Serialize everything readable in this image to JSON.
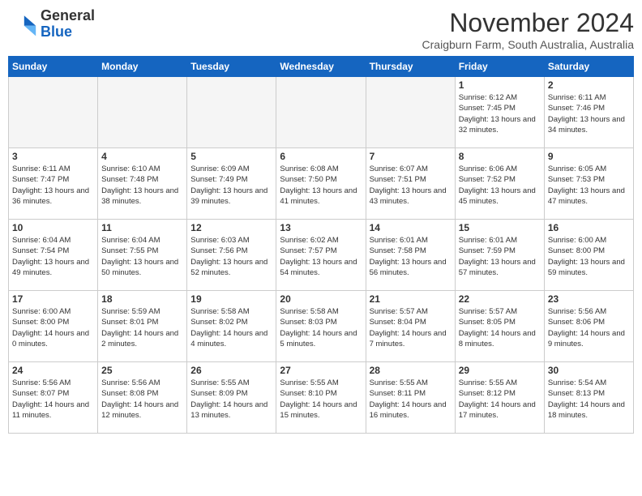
{
  "header": {
    "logo_line1": "General",
    "logo_line2": "Blue",
    "month": "November 2024",
    "location": "Craigburn Farm, South Australia, Australia"
  },
  "days_of_week": [
    "Sunday",
    "Monday",
    "Tuesday",
    "Wednesday",
    "Thursday",
    "Friday",
    "Saturday"
  ],
  "weeks": [
    [
      {
        "num": "",
        "empty": true
      },
      {
        "num": "",
        "empty": true
      },
      {
        "num": "",
        "empty": true
      },
      {
        "num": "",
        "empty": true
      },
      {
        "num": "",
        "empty": true
      },
      {
        "num": "1",
        "sunrise": "6:12 AM",
        "sunset": "7:45 PM",
        "daylight": "13 hours and 32 minutes."
      },
      {
        "num": "2",
        "sunrise": "6:11 AM",
        "sunset": "7:46 PM",
        "daylight": "13 hours and 34 minutes."
      }
    ],
    [
      {
        "num": "3",
        "sunrise": "6:11 AM",
        "sunset": "7:47 PM",
        "daylight": "13 hours and 36 minutes."
      },
      {
        "num": "4",
        "sunrise": "6:10 AM",
        "sunset": "7:48 PM",
        "daylight": "13 hours and 38 minutes."
      },
      {
        "num": "5",
        "sunrise": "6:09 AM",
        "sunset": "7:49 PM",
        "daylight": "13 hours and 39 minutes."
      },
      {
        "num": "6",
        "sunrise": "6:08 AM",
        "sunset": "7:50 PM",
        "daylight": "13 hours and 41 minutes."
      },
      {
        "num": "7",
        "sunrise": "6:07 AM",
        "sunset": "7:51 PM",
        "daylight": "13 hours and 43 minutes."
      },
      {
        "num": "8",
        "sunrise": "6:06 AM",
        "sunset": "7:52 PM",
        "daylight": "13 hours and 45 minutes."
      },
      {
        "num": "9",
        "sunrise": "6:05 AM",
        "sunset": "7:53 PM",
        "daylight": "13 hours and 47 minutes."
      }
    ],
    [
      {
        "num": "10",
        "sunrise": "6:04 AM",
        "sunset": "7:54 PM",
        "daylight": "13 hours and 49 minutes."
      },
      {
        "num": "11",
        "sunrise": "6:04 AM",
        "sunset": "7:55 PM",
        "daylight": "13 hours and 50 minutes."
      },
      {
        "num": "12",
        "sunrise": "6:03 AM",
        "sunset": "7:56 PM",
        "daylight": "13 hours and 52 minutes."
      },
      {
        "num": "13",
        "sunrise": "6:02 AM",
        "sunset": "7:57 PM",
        "daylight": "13 hours and 54 minutes."
      },
      {
        "num": "14",
        "sunrise": "6:01 AM",
        "sunset": "7:58 PM",
        "daylight": "13 hours and 56 minutes."
      },
      {
        "num": "15",
        "sunrise": "6:01 AM",
        "sunset": "7:59 PM",
        "daylight": "13 hours and 57 minutes."
      },
      {
        "num": "16",
        "sunrise": "6:00 AM",
        "sunset": "8:00 PM",
        "daylight": "13 hours and 59 minutes."
      }
    ],
    [
      {
        "num": "17",
        "sunrise": "6:00 AM",
        "sunset": "8:00 PM",
        "daylight": "14 hours and 0 minutes."
      },
      {
        "num": "18",
        "sunrise": "5:59 AM",
        "sunset": "8:01 PM",
        "daylight": "14 hours and 2 minutes."
      },
      {
        "num": "19",
        "sunrise": "5:58 AM",
        "sunset": "8:02 PM",
        "daylight": "14 hours and 4 minutes."
      },
      {
        "num": "20",
        "sunrise": "5:58 AM",
        "sunset": "8:03 PM",
        "daylight": "14 hours and 5 minutes."
      },
      {
        "num": "21",
        "sunrise": "5:57 AM",
        "sunset": "8:04 PM",
        "daylight": "14 hours and 7 minutes."
      },
      {
        "num": "22",
        "sunrise": "5:57 AM",
        "sunset": "8:05 PM",
        "daylight": "14 hours and 8 minutes."
      },
      {
        "num": "23",
        "sunrise": "5:56 AM",
        "sunset": "8:06 PM",
        "daylight": "14 hours and 9 minutes."
      }
    ],
    [
      {
        "num": "24",
        "sunrise": "5:56 AM",
        "sunset": "8:07 PM",
        "daylight": "14 hours and 11 minutes."
      },
      {
        "num": "25",
        "sunrise": "5:56 AM",
        "sunset": "8:08 PM",
        "daylight": "14 hours and 12 minutes."
      },
      {
        "num": "26",
        "sunrise": "5:55 AM",
        "sunset": "8:09 PM",
        "daylight": "14 hours and 13 minutes."
      },
      {
        "num": "27",
        "sunrise": "5:55 AM",
        "sunset": "8:10 PM",
        "daylight": "14 hours and 15 minutes."
      },
      {
        "num": "28",
        "sunrise": "5:55 AM",
        "sunset": "8:11 PM",
        "daylight": "14 hours and 16 minutes."
      },
      {
        "num": "29",
        "sunrise": "5:55 AM",
        "sunset": "8:12 PM",
        "daylight": "14 hours and 17 minutes."
      },
      {
        "num": "30",
        "sunrise": "5:54 AM",
        "sunset": "8:13 PM",
        "daylight": "14 hours and 18 minutes."
      }
    ]
  ],
  "colors": {
    "header_bg": "#1565C0",
    "shaded_bg": "#f0f0f0",
    "empty_bg": "#f5f5f5"
  }
}
